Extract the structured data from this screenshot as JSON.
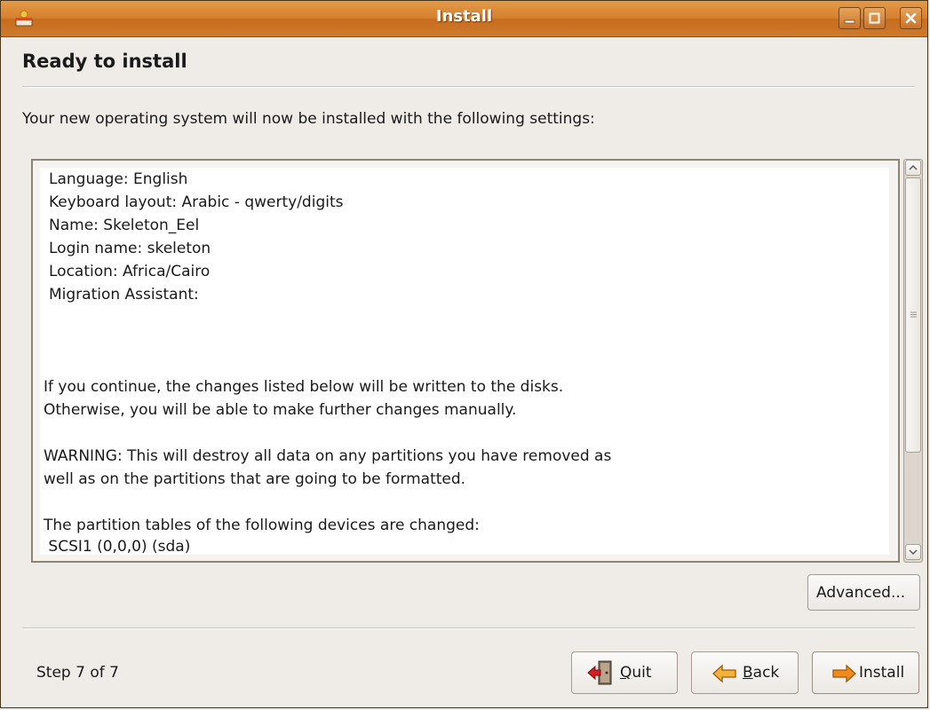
{
  "window": {
    "title": "Install",
    "icons": {
      "app": "installer-icon",
      "minimize": "minimize-icon",
      "maximize": "maximize-icon",
      "close": "close-icon"
    }
  },
  "page": {
    "heading": "Ready to install",
    "intro": "Your new operating system will now be installed with the following settings:"
  },
  "summary": {
    "lines": [
      "Language: English",
      "Keyboard layout: Arabic - qwerty/digits",
      "Name: Skeleton_Eel",
      "Login name: skeleton",
      "Location: Africa/Cairo",
      "Migration Assistant:"
    ],
    "paragraphs": [
      "If you continue, the changes listed below will be written to the disks.",
      "Otherwise, you will be able to make further changes manually.",
      "WARNING: This will destroy all data on any partitions you have removed as",
      "well as on the partitions that are going to be formatted.",
      "The partition tables of the following devices are changed:",
      " SCSI1 (0,0,0) (sda)"
    ]
  },
  "buttons": {
    "advanced": "Advanced...",
    "quit": {
      "first": "Q",
      "rest": "uit"
    },
    "back": {
      "first": "B",
      "rest": "ack"
    },
    "install": "Install"
  },
  "footer": {
    "step": "Step 7 of 7"
  },
  "colors": {
    "titlebar": "#d6802f",
    "background": "#efebe7",
    "arrow_orange": "#f08a1c",
    "quit_red": "#d02020"
  }
}
